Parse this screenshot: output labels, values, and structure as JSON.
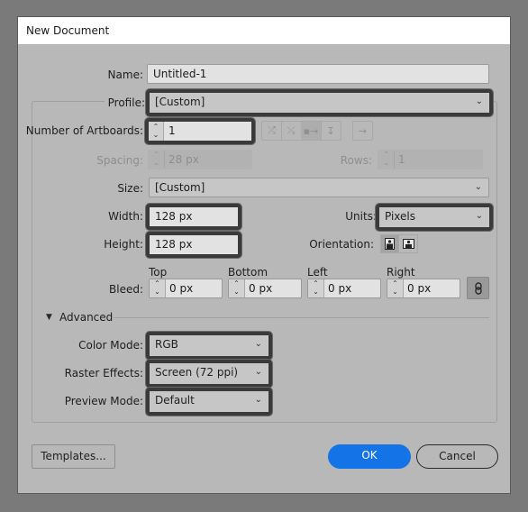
{
  "dialog": {
    "title": "New Document"
  },
  "name": {
    "label": "Name:",
    "value": "Untitled-1"
  },
  "profile": {
    "label": "Profile:",
    "value": "[Custom]"
  },
  "artboards": {
    "label": "Number of Artboards:",
    "value": "1",
    "layout_icons": [
      "grid-by-row-icon",
      "grid-by-column-icon",
      "arrange-by-row-icon",
      "arrange-by-column-icon"
    ],
    "direction_icon": "right-to-left-arrow-icon"
  },
  "spacing": {
    "label": "Spacing:",
    "value": "28 px"
  },
  "rows": {
    "label": "Rows:",
    "value": "1"
  },
  "size": {
    "label": "Size:",
    "value": "[Custom]"
  },
  "width": {
    "label": "Width:",
    "value": "128 px"
  },
  "height": {
    "label": "Height:",
    "value": "128 px"
  },
  "units": {
    "label": "Units:",
    "value": "Pixels"
  },
  "orientation": {
    "label": "Orientation:",
    "options": [
      "portrait",
      "landscape"
    ],
    "selected": "portrait"
  },
  "bleed": {
    "label": "Bleed:",
    "fields": [
      {
        "header": "Top",
        "value": "0 px"
      },
      {
        "header": "Bottom",
        "value": "0 px"
      },
      {
        "header": "Left",
        "value": "0 px"
      },
      {
        "header": "Right",
        "value": "0 px"
      }
    ]
  },
  "advanced": {
    "label": "Advanced",
    "color_mode": {
      "label": "Color Mode:",
      "value": "RGB"
    },
    "raster_effects": {
      "label": "Raster Effects:",
      "value": "Screen (72 ppi)"
    },
    "preview_mode": {
      "label": "Preview Mode:",
      "value": "Default"
    }
  },
  "buttons": {
    "templates": "Templates...",
    "ok": "OK",
    "cancel": "Cancel"
  },
  "colors": {
    "accent": "#1473e6",
    "dialog_bg": "#b8b8b8",
    "highlight_outline": "#3a3a3a"
  }
}
